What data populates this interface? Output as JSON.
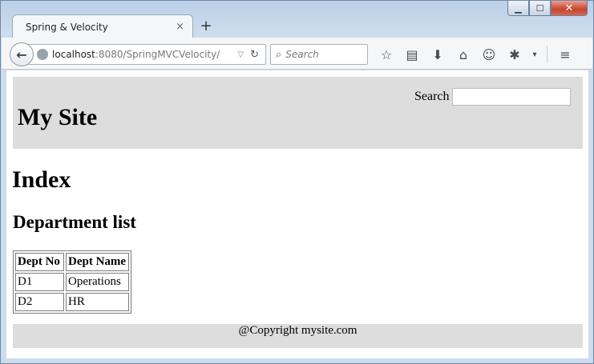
{
  "window": {
    "minimize_label": "▁",
    "maximize_label": "☐",
    "close_label": "✕"
  },
  "tab": {
    "title": "Spring & Velocity",
    "close_label": "×",
    "new_tab_label": "+"
  },
  "nav": {
    "back_label": "←",
    "url_host": "localhost",
    "url_path": ":8080/SpringMVCVelocity/",
    "dropdown_label": "▽",
    "reload_label": "↻",
    "search_placeholder": "Search",
    "search_icon": "⌕"
  },
  "toolbar": {
    "icons": [
      "star-icon",
      "reading-list-icon",
      "download-icon",
      "home-icon",
      "smiley-icon",
      "addon-icon",
      "dropdown-icon",
      "menu-icon"
    ],
    "star_label": "☆",
    "list_label": "▤",
    "download_label": "⬇",
    "home_label": "⌂",
    "smiley_label": "☺",
    "addon_label": "✱",
    "dropdown_label": "▾",
    "menu_label": "≡"
  },
  "site": {
    "title": "My Site",
    "search_label": "Search",
    "search_value": ""
  },
  "page": {
    "title": "Index",
    "section_title": "Department list"
  },
  "table": {
    "headers": [
      "Dept No",
      "Dept Name"
    ],
    "rows": [
      [
        "D1",
        "Operations"
      ],
      [
        "D2",
        "HR"
      ]
    ]
  },
  "footer": {
    "text": "@Copyright mysite.com"
  }
}
